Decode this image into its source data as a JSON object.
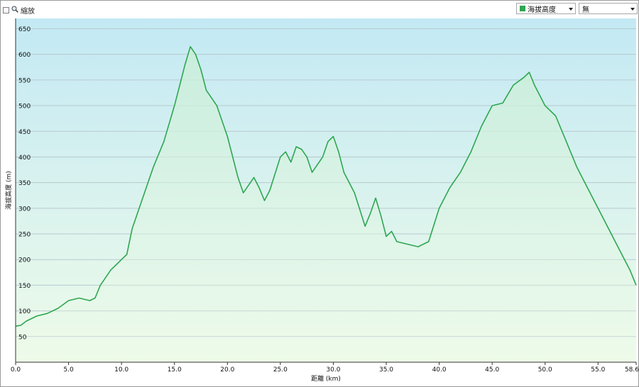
{
  "toolbar": {
    "zoom_label": "縮放",
    "series_select": {
      "value": "海拔高度",
      "color": "#2ea651"
    },
    "compare_select": {
      "value": "無"
    }
  },
  "chart_data": {
    "type": "area",
    "xlabel": "距離 (km)",
    "ylabel": "海拔高度 (m)",
    "xlim": [
      0,
      58.6
    ],
    "ylim": [
      0,
      670
    ],
    "xticks": [
      "0.0",
      "5.0",
      "10.0",
      "15.0",
      "20.0",
      "25.0",
      "30.0",
      "35.0",
      "40.0",
      "45.0",
      "50.0",
      "55.0",
      "58.6"
    ],
    "xtick_values": [
      0,
      5,
      10,
      15,
      20,
      25,
      30,
      35,
      40,
      45,
      50,
      55,
      58.6
    ],
    "yticks": [
      50,
      100,
      150,
      200,
      250,
      300,
      350,
      400,
      450,
      500,
      550,
      600,
      650
    ],
    "grid": true,
    "line_color": "#2ea651",
    "fill_top": "#c9eed7",
    "background_top": "#c3e9f4",
    "background_bottom": "#eefbe9",
    "series": [
      {
        "x": [
          0,
          0.5,
          1,
          2,
          3,
          4,
          5,
          6,
          7,
          7.5,
          8,
          8.5,
          9,
          9.5,
          10,
          10.5,
          11,
          12,
          13,
          14,
          15,
          15.5,
          16,
          16.5,
          17,
          17.5,
          18,
          19,
          20,
          21,
          21.5,
          22,
          22.5,
          23,
          23.5,
          24,
          25,
          25.5,
          26,
          26.5,
          27,
          27.5,
          28,
          29,
          29.5,
          30,
          30.5,
          31,
          32,
          33,
          33.5,
          34,
          34.5,
          35,
          35.5,
          36,
          37,
          38,
          39,
          40,
          41,
          42,
          43,
          44,
          45,
          46,
          47,
          48,
          48.5,
          49,
          50,
          51,
          52,
          53,
          54,
          55,
          56,
          57,
          58,
          58.6
        ],
        "y": [
          70,
          72,
          80,
          90,
          95,
          105,
          120,
          125,
          120,
          125,
          150,
          165,
          180,
          190,
          200,
          210,
          260,
          320,
          380,
          430,
          500,
          540,
          580,
          615,
          600,
          570,
          530,
          500,
          440,
          360,
          330,
          345,
          360,
          340,
          315,
          335,
          400,
          410,
          390,
          420,
          415,
          400,
          370,
          400,
          430,
          440,
          410,
          370,
          330,
          265,
          290,
          320,
          285,
          245,
          255,
          235,
          230,
          225,
          235,
          300,
          340,
          370,
          410,
          460,
          500,
          505,
          540,
          555,
          565,
          540,
          500,
          480,
          430,
          380,
          340,
          300,
          260,
          220,
          180,
          150
        ]
      }
    ]
  }
}
